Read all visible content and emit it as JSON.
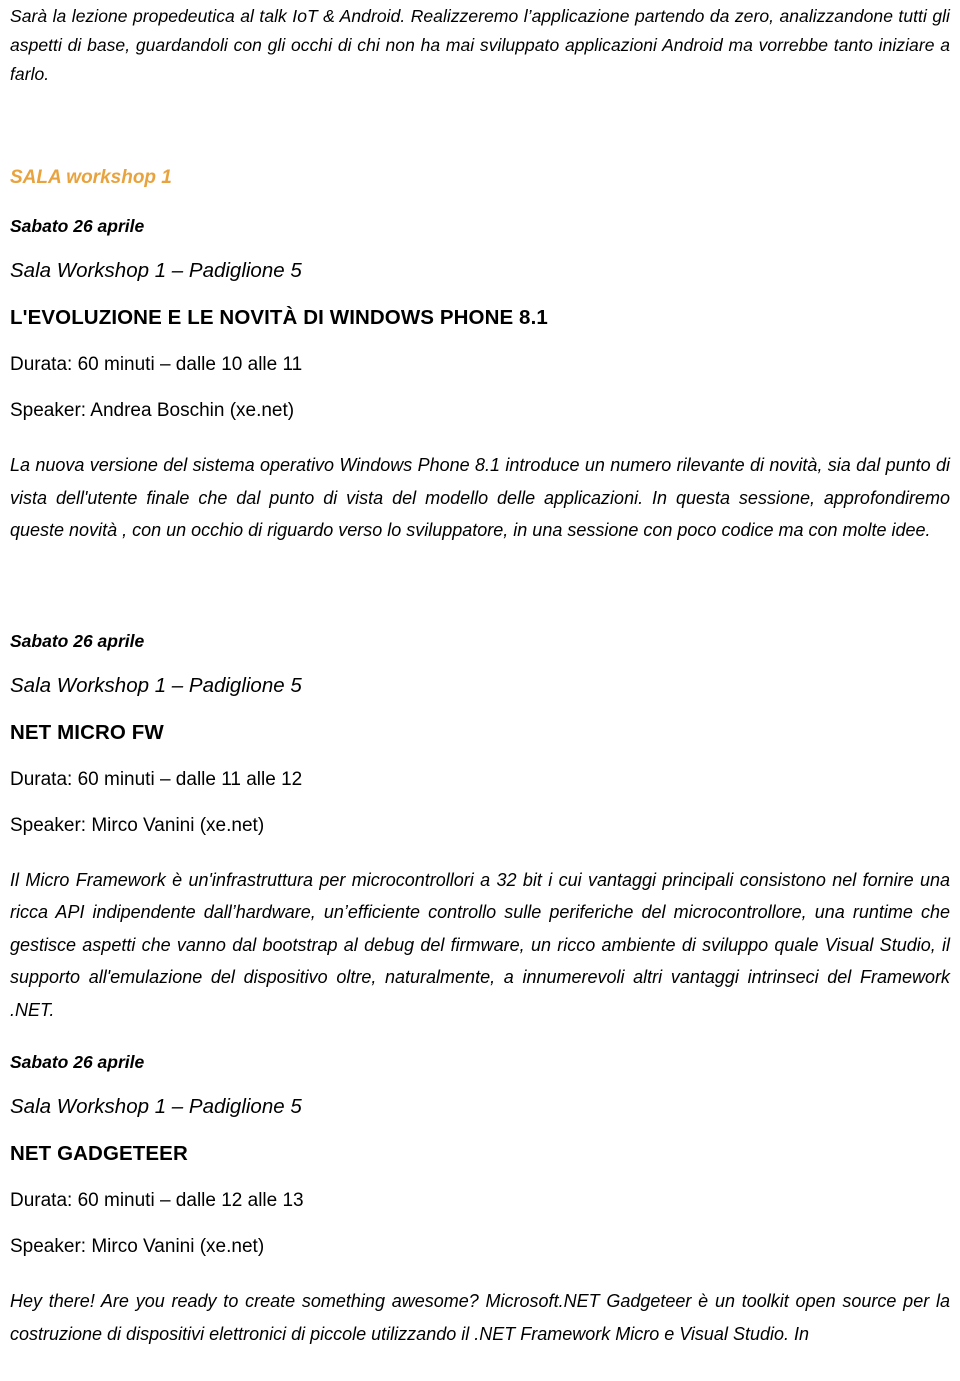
{
  "document": {
    "intro_paragraph": "Sarà la lezione propedeutica al talk IoT & Android. Realizzeremo l’applicazione partendo da zero, analizzandone tutti gli aspetti di base, guardandoli con gli occhi di chi non ha mai sviluppato applicazioni Android ma vorrebbe tanto iniziare a farlo.",
    "room_heading": "SALA workshop 1",
    "room_heading_color": "#E8A33E",
    "sessions": [
      {
        "date": "Sabato 26 aprile",
        "venue": "Sala Workshop 1 – Padiglione 5",
        "title": "L'EVOLUZIONE E LE NOVITÀ DI WINDOWS PHONE 8.1",
        "duration": "Durata: 60 minuti – dalle 10 alle 11",
        "speaker": "Speaker: Andrea Boschin (xe.net)",
        "abstract": "La nuova versione del sistema operativo Windows Phone 8.1 introduce un numero rilevante di novità, sia dal punto di vista dell'utente finale che dal punto di vista del modello delle applicazioni. In questa sessione, approfondiremo queste novità , con un occhio di riguardo verso lo sviluppatore, in una sessione con poco codice ma con molte idee."
      },
      {
        "date": "Sabato 26 aprile",
        "venue": "Sala Workshop 1 – Padiglione 5",
        "title": "NET MICRO FW",
        "duration": "Durata: 60 minuti – dalle 11 alle 12",
        "speaker": "Speaker: Mirco Vanini (xe.net)",
        "abstract": "Il Micro Framework è un'infrastruttura per microcontrollori a 32 bit i cui vantaggi principali consistono nel fornire una ricca API indipendente dall’hardware, un’efficiente controllo sulle periferiche del microcontrollore, una runtime che gestisce aspetti che vanno dal bootstrap al debug del firmware, un ricco ambiente di sviluppo quale Visual Studio, il supporto all'emulazione del dispositivo oltre, naturalmente, a innumerevoli altri vantaggi intrinseci del Framework .NET."
      },
      {
        "date": "Sabato 26 aprile",
        "venue": "Sala Workshop 1 – Padiglione 5",
        "title": "NET GADGETEER",
        "duration": "Durata: 60 minuti – dalle 12 alle 13",
        "speaker": "Speaker: Mirco Vanini (xe.net)",
        "abstract": "Hey there! Are you ready to create something awesome? Microsoft.NET Gadgeteer è un toolkit open source per la costruzione di dispositivi elettronici di piccole utilizzando il .NET Framework Micro e Visual Studio. In"
      }
    ]
  }
}
